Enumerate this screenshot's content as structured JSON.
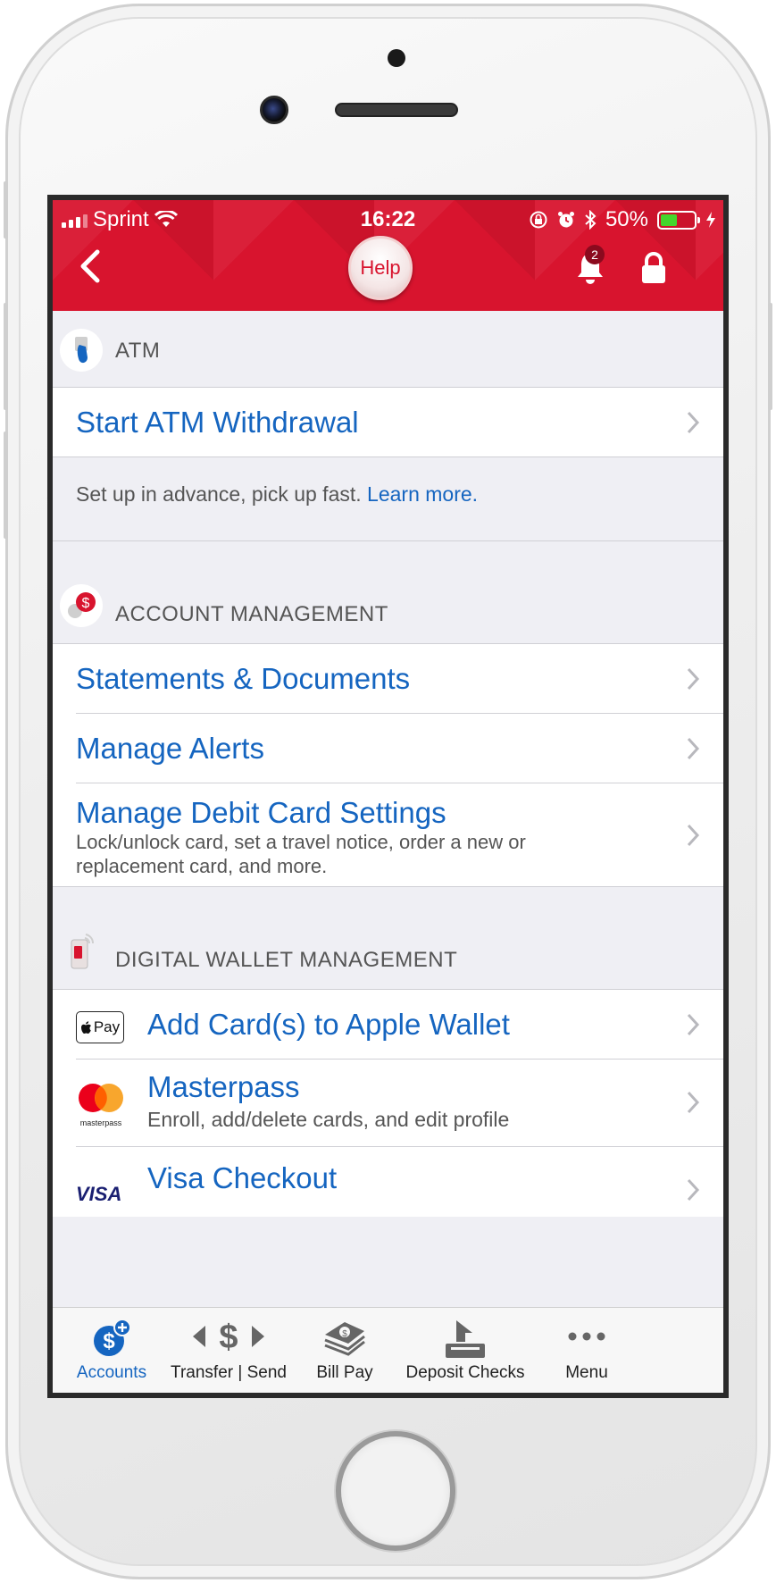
{
  "status_bar": {
    "carrier": "Sprint",
    "time": "16:22",
    "battery_pct": "50%"
  },
  "header": {
    "help_label": "Help",
    "notification_count": "2"
  },
  "sections": {
    "atm": {
      "title": "ATM",
      "items": [
        {
          "label": "Start ATM Withdrawal"
        }
      ],
      "info_text": "Set up in advance, pick up fast.",
      "info_link": "Learn more."
    },
    "account_management": {
      "title": "ACCOUNT MANAGEMENT",
      "items": [
        {
          "label": "Statements & Documents"
        },
        {
          "label": "Manage Alerts"
        },
        {
          "label": "Manage Debit Card Settings",
          "subtitle": "Lock/unlock card, set a travel notice, order a new or replacement card, and more."
        }
      ]
    },
    "digital_wallet": {
      "title": "DIGITAL WALLET MANAGEMENT",
      "items": [
        {
          "label": "Add Card(s) to Apple Wallet",
          "icon_text": "Pay"
        },
        {
          "label": "Masterpass",
          "subtitle": "Enroll, add/delete cards, and edit profile",
          "icon_text": "masterpass"
        },
        {
          "label": "Visa Checkout",
          "icon_text": "VISA"
        }
      ]
    }
  },
  "tabs": [
    {
      "label": "Accounts",
      "active": true
    },
    {
      "label": "Transfer | Send"
    },
    {
      "label": "Bill Pay"
    },
    {
      "label": "Deposit Checks"
    },
    {
      "label": "Menu"
    }
  ],
  "colors": {
    "brand_red": "#d8142e",
    "link_blue": "#1565c0",
    "background_gray": "#efeff4"
  }
}
